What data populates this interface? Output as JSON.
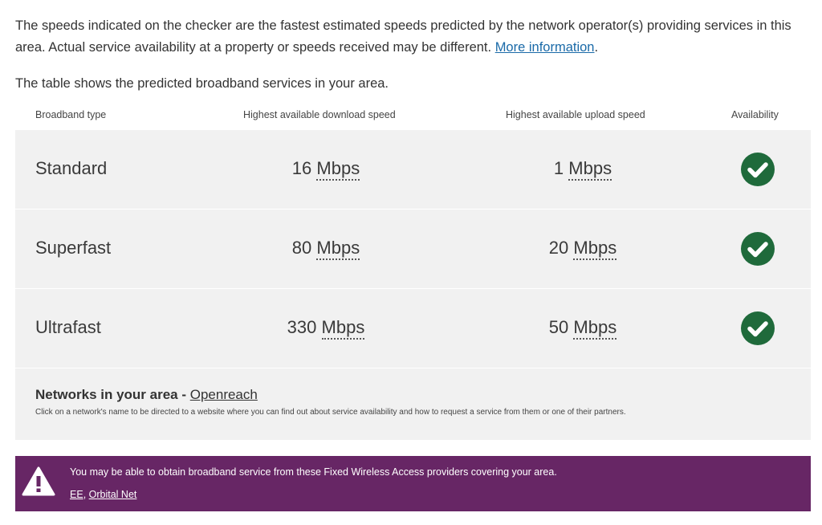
{
  "intro": {
    "text": "The speeds indicated on the checker are the fastest estimated speeds predicted by the network operator(s) providing services in this area. Actual service availability at a property or speeds received may be different. ",
    "link": "More information",
    "suffix": "."
  },
  "lead": "The table shows the predicted broadband services in your area.",
  "table": {
    "headers": {
      "type": "Broadband type",
      "download": "Highest available download speed",
      "upload": "Highest available upload speed",
      "availability": "Availability"
    },
    "rows": [
      {
        "type": "Standard",
        "download": "16",
        "upload": "1",
        "unit": "Mbps",
        "available": true
      },
      {
        "type": "Superfast",
        "download": "80",
        "upload": "20",
        "unit": "Mbps",
        "available": true
      },
      {
        "type": "Ultrafast",
        "download": "330",
        "upload": "50",
        "unit": "Mbps",
        "available": true
      }
    ]
  },
  "networks": {
    "title": "Networks in your area - ",
    "link": "Openreach",
    "note": "Click on a network's name to be directed to a website where you can find out about service availability and how to request a service from them or one of their partners."
  },
  "banner": {
    "message": "You may be able to obtain broadband service from these Fixed Wireless Access providers covering your area.",
    "providers": [
      "EE",
      "Orbital Net"
    ],
    "separator": ", ",
    "color": "#672665",
    "icon": "warning-icon"
  },
  "colors": {
    "check": "#1f6a3b",
    "link": "#1a6aa8",
    "row_bg": "#f1f1f1"
  }
}
